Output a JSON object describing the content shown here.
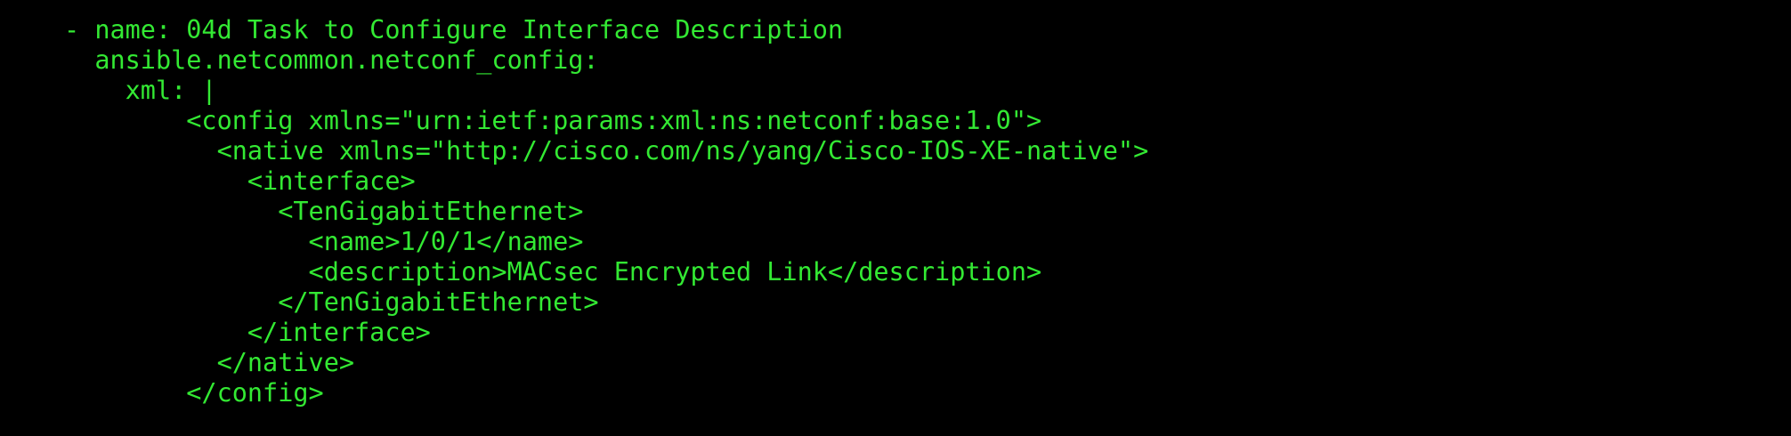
{
  "terminal": {
    "text_color": "#33e933",
    "background_color": "#000000",
    "lines": [
      "- name: 04d Task to Configure Interface Description",
      "  ansible.netcommon.netconf_config:",
      "    xml: |",
      "        <config xmlns=\"urn:ietf:params:xml:ns:netconf:base:1.0\">",
      "          <native xmlns=\"http://cisco.com/ns/yang/Cisco-IOS-XE-native\">",
      "            <interface>",
      "              <TenGigabitEthernet>",
      "                <name>1/0/1</name>",
      "                <description>MACsec Encrypted Link</description>",
      "              </TenGigabitEthernet>",
      "            </interface>",
      "          </native>",
      "        </config>"
    ]
  }
}
